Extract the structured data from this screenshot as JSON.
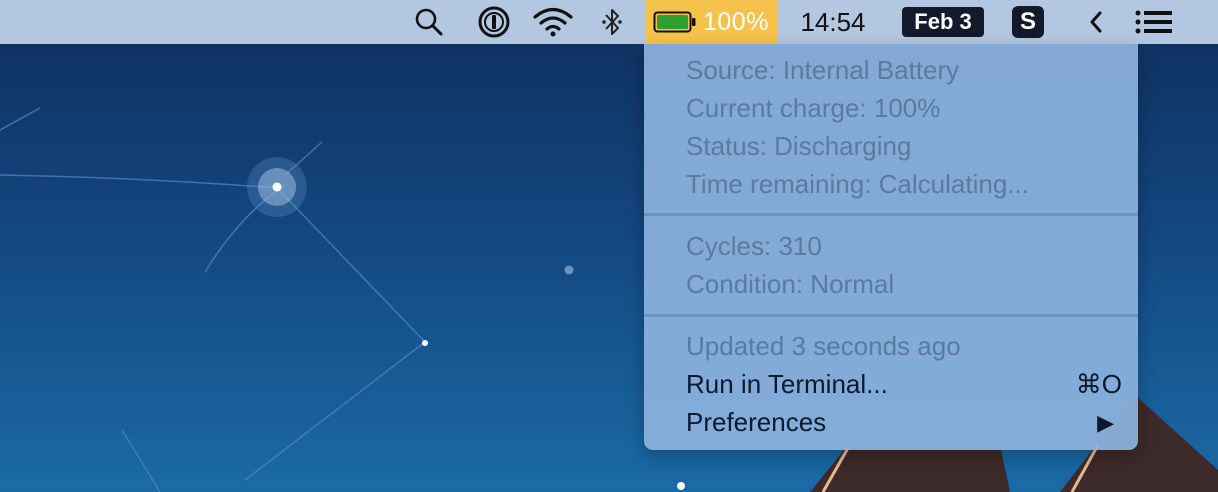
{
  "menubar": {
    "battery_percent": "100%",
    "battery_level": 1.0,
    "time": "14:54",
    "date": "Feb 3",
    "app_badge": "S"
  },
  "battery_menu": {
    "info": {
      "source": "Source: Internal Battery",
      "current_charge": "Current charge: 100%",
      "status": "Status: Discharging",
      "time_remaining": "Time remaining: Calculating..."
    },
    "health": {
      "cycles": "Cycles: 310",
      "condition": "Condition: Normal"
    },
    "footer": {
      "updated": "Updated 3 seconds ago",
      "run_in_terminal": "Run in Terminal...",
      "run_in_terminal_shortcut": "⌘O",
      "preferences": "Preferences",
      "preferences_arrow": "▶"
    }
  },
  "icons": [
    "search-icon",
    "1password-icon",
    "wifi-icon",
    "bluetooth-icon",
    "battery-icon",
    "chevron-left-icon",
    "list-menu-icon"
  ],
  "colors": {
    "menubar_bg": "#b4c7e0",
    "battery_highlight": "#f5c34c",
    "battery_fill": "#2e9e2e",
    "dropdown_bg": "#8cb2de",
    "disabled_text": "#5a7aa0",
    "enabled_text": "#0b1a2e"
  }
}
